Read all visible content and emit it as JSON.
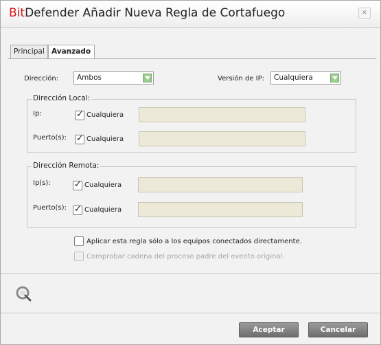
{
  "window": {
    "title_brand": "Bit",
    "title_rest": "Defender Añadir Nueva Regla de Cortafuego",
    "close_label": "×"
  },
  "tabs": [
    {
      "label": "Principal",
      "active": false
    },
    {
      "label": "Avanzado",
      "active": true
    }
  ],
  "direction": {
    "label": "Dirección:",
    "value": "Ambos"
  },
  "ip_version": {
    "label": "Versión de IP:",
    "value": "Cualquiera"
  },
  "local": {
    "legend": "Dirección Local:",
    "ip_label": "Ip:",
    "ip_any_label": "Cualquiera",
    "ip_any_checked": true,
    "ip_value": "",
    "port_label": "Puerto(s):",
    "port_any_label": "Cualquiera",
    "port_any_checked": true,
    "port_value": ""
  },
  "remote": {
    "legend": "Dirección Remota:",
    "ip_label": "Ip(s):",
    "ip_any_label": "Cualquiera",
    "ip_any_checked": true,
    "ip_value": "",
    "port_label": "Puerto(s):",
    "port_any_label": "Cualquiera",
    "port_any_checked": true,
    "port_value": ""
  },
  "options": {
    "direct_only_label": "Aplicar esta regla sólo a los equipos conectados directamente.",
    "direct_only_checked": false,
    "parent_chain_label": "Comprobar cadena del proceso padre del evento original.",
    "parent_chain_checked": false,
    "parent_chain_enabled": false
  },
  "footer": {
    "icon": "bitdefender-q-icon",
    "accept_label": "Aceptar",
    "cancel_label": "Cancelar"
  },
  "colors": {
    "brand_red": "#d8151d",
    "dropdown_arrow": "#9ccf8f",
    "field_bg": "#ece9d8"
  }
}
